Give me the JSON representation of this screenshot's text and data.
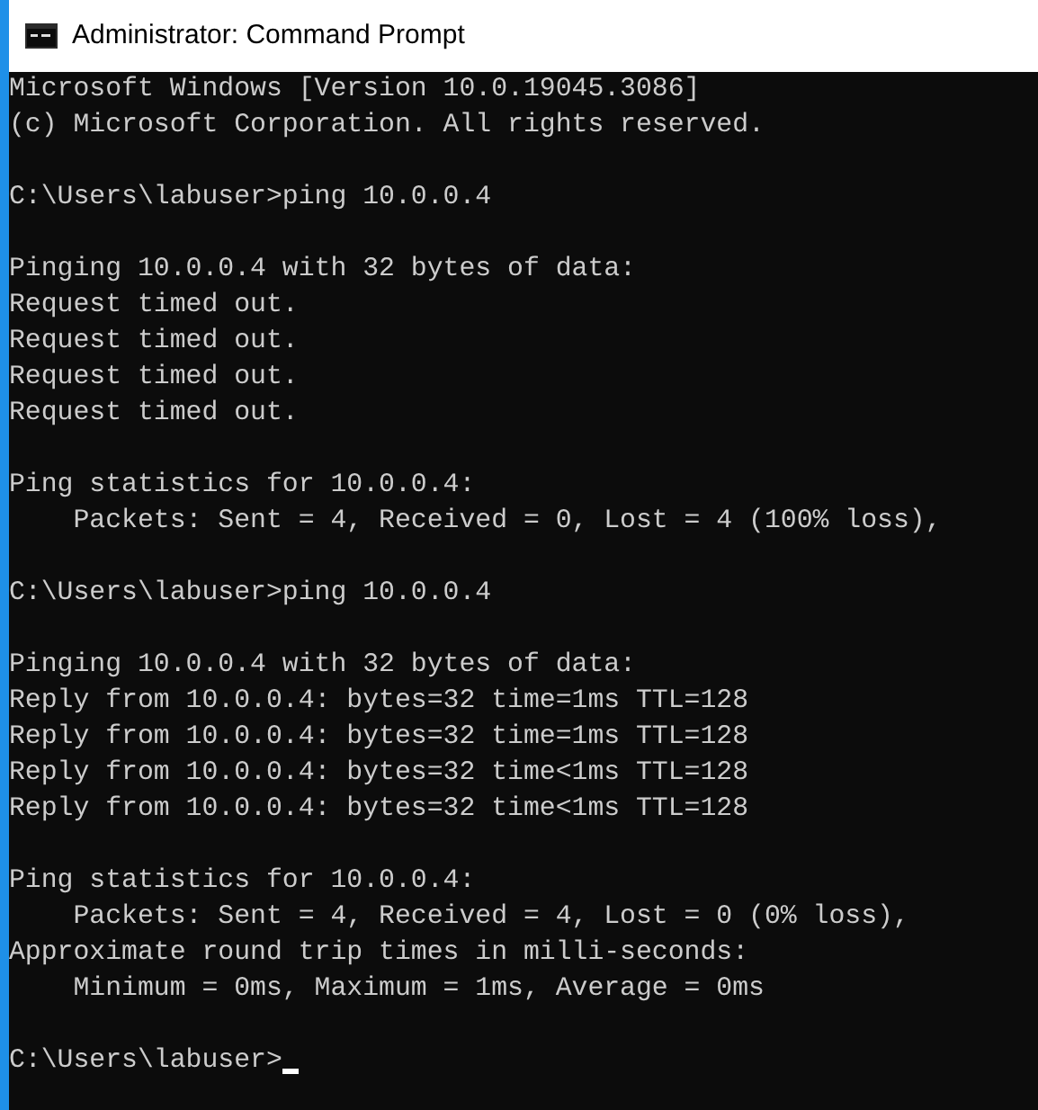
{
  "window": {
    "title": "Administrator: Command Prompt"
  },
  "console": {
    "cursor_visible": true,
    "blocks": [
      [
        "Microsoft Windows [Version 10.0.19045.3086]",
        "(c) Microsoft Corporation. All rights reserved."
      ],
      [
        "C:\\Users\\labuser>ping 10.0.0.4"
      ],
      [
        "Pinging 10.0.0.4 with 32 bytes of data:",
        "Request timed out.",
        "Request timed out.",
        "Request timed out.",
        "Request timed out."
      ],
      [
        "Ping statistics for 10.0.0.4:",
        "    Packets: Sent = 4, Received = 0, Lost = 4 (100% loss),"
      ],
      [
        "C:\\Users\\labuser>ping 10.0.0.4"
      ],
      [
        "Pinging 10.0.0.4 with 32 bytes of data:",
        "Reply from 10.0.0.4: bytes=32 time=1ms TTL=128",
        "Reply from 10.0.0.4: bytes=32 time=1ms TTL=128",
        "Reply from 10.0.0.4: bytes=32 time<1ms TTL=128",
        "Reply from 10.0.0.4: bytes=32 time<1ms TTL=128"
      ],
      [
        "Ping statistics for 10.0.0.4:",
        "    Packets: Sent = 4, Received = 4, Lost = 0 (0% loss),",
        "Approximate round trip times in milli-seconds:",
        "    Minimum = 0ms, Maximum = 1ms, Average = 0ms"
      ],
      [
        "C:\\Users\\labuser>"
      ]
    ]
  }
}
